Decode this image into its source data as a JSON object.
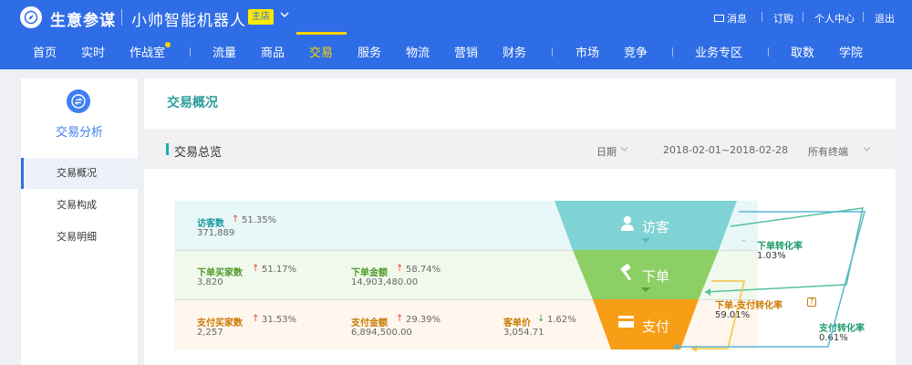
{
  "app": {
    "name": "生意参谋",
    "shop_name": "小帅智能机器人",
    "shop_badge": "主店"
  },
  "top_links": {
    "message": "消息",
    "subscribe": "订购",
    "personal": "个人中心",
    "logout": "退出"
  },
  "nav": [
    "首页",
    "实时",
    "作战室",
    "流量",
    "商品",
    "交易",
    "服务",
    "物流",
    "营销",
    "财务",
    "市场",
    "竞争",
    "业务专区",
    "取数",
    "学院"
  ],
  "nav_active": "交易",
  "sidebar": {
    "title": "交易分析",
    "items": [
      "交易概况",
      "交易构成",
      "交易明细"
    ],
    "active": "交易概况"
  },
  "page": {
    "title": "交易概况"
  },
  "section": {
    "title": "交易总览",
    "date_label": "日期",
    "date_range": "2018-02-01~2018-02-28",
    "terminal": "所有终端"
  },
  "metrics": {
    "visitors": {
      "label": "访客数",
      "pct": "51.35%",
      "value": "371,889"
    },
    "order_buyers": {
      "label": "下单买家数",
      "pct": "51.17%",
      "value": "3,820"
    },
    "order_amount": {
      "label": "下单金额",
      "pct": "58.74%",
      "value": "14,903,480.00"
    },
    "pay_buyers": {
      "label": "支付买家数",
      "pct": "31.53%",
      "value": "2,257"
    },
    "pay_amount": {
      "label": "支付金额",
      "pct": "29.39%",
      "value": "6,894,500.00"
    },
    "unit_price": {
      "label": "客单价",
      "pct": "1.62%",
      "value": "3,054.71"
    }
  },
  "funnel": {
    "stage1": "访客",
    "stage2": "下单",
    "stage3": "支付"
  },
  "rates": {
    "order_rate": {
      "label": "下单转化率",
      "value": "1.03%"
    },
    "order_pay_rate": {
      "label": "下单-支付转化率",
      "value": "59.01%"
    },
    "pay_rate": {
      "label": "支付转化率",
      "value": "0.61%"
    }
  },
  "colors": {
    "primary": "#2f6de6",
    "accent_yellow": "#ffd200",
    "teal": "#7fd3d4",
    "green": "#8ccf64",
    "orange": "#f79d16",
    "up_arrow": "#ef3d3d",
    "down_arrow": "#33a544"
  }
}
